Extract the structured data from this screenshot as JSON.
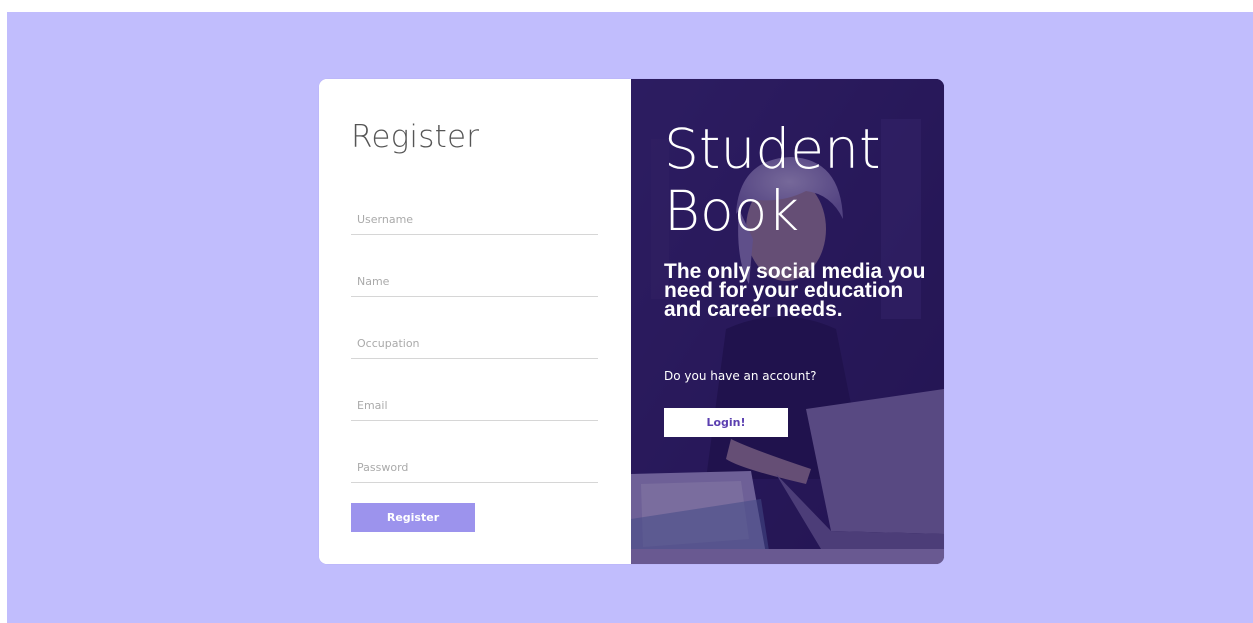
{
  "register": {
    "title": "Register",
    "fields": [
      {
        "placeholder": "Username",
        "value": ""
      },
      {
        "placeholder": "Name",
        "value": ""
      },
      {
        "placeholder": "Occupation",
        "value": ""
      },
      {
        "placeholder": "Email",
        "value": ""
      },
      {
        "placeholder": "Password",
        "value": ""
      }
    ],
    "submit_label": "Register"
  },
  "promo": {
    "brand_line_1": "Student",
    "brand_line_2": "Book",
    "tagline": "The only social media you need for your education and career needs.",
    "question": "Do you have an account?",
    "login_label": "Login!"
  },
  "colors": {
    "page_background": "#c1bdfd",
    "register_button": "#9c93ed",
    "promo_overlay": "#221058",
    "login_text": "#5b3fb0"
  }
}
